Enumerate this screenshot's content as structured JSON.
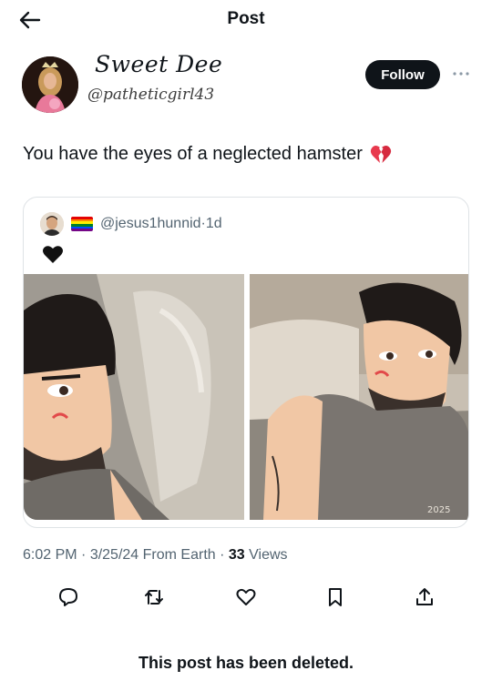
{
  "header": {
    "title": "Post",
    "back_icon": "arrow-left-icon"
  },
  "author": {
    "display_name": "Sweet Dee",
    "handle": "@patheticgirl43",
    "follow_label": "Follow",
    "more_icon": "more-dots-icon"
  },
  "post": {
    "text": "You have the eyes of a neglected hamster",
    "emoji": "broken-heart-icon"
  },
  "quoted": {
    "handle": "@jesus1hunnid",
    "separator": " · ",
    "age": "1d",
    "flag_icon": "rainbow-flag-icon",
    "heart_icon": "black-heart-icon",
    "image_watermark": "2025"
  },
  "meta": {
    "time": "6:02 PM",
    "date": "3/25/24",
    "source": "From Earth",
    "views_count": "33",
    "views_label": "Views",
    "sep": " · "
  },
  "actions": [
    "reply-icon",
    "repost-icon",
    "like-icon",
    "bookmark-icon",
    "share-icon"
  ],
  "notice": {
    "text": "This post has been deleted."
  },
  "colors": {
    "text": "#0f1419",
    "muted": "#536471",
    "border": "#dfe3e6",
    "broken_heart": "#e8394d"
  }
}
